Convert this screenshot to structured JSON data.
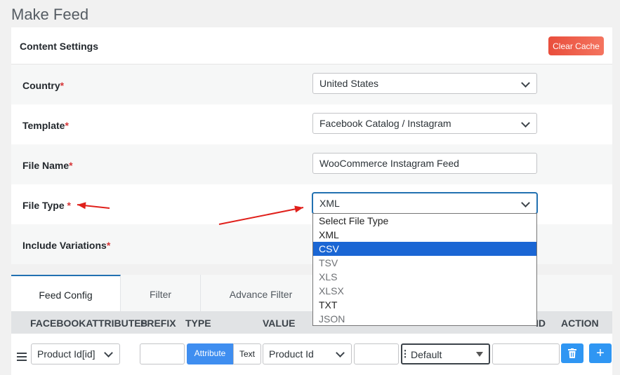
{
  "page": {
    "title": "Make Feed"
  },
  "content_settings": {
    "title": "Content Settings",
    "clear_cache_label": "Clear Cache",
    "fields": {
      "country": {
        "label": "Country",
        "required_mark": "*",
        "value": "United States"
      },
      "template": {
        "label": "Template",
        "required_mark": "*",
        "value": "Facebook Catalog / Instagram"
      },
      "file_name": {
        "label": "File Name",
        "required_mark": "*",
        "value": "WooCommerce Instagram Feed"
      },
      "file_type": {
        "label": "File Type",
        "required_mark": " *",
        "value": "XML"
      },
      "include_variations": {
        "label": "Include Variations",
        "required_mark": "*"
      }
    }
  },
  "file_type_dropdown": {
    "options": [
      "Select File Type",
      "XML",
      "CSV",
      "TSV",
      "XLS",
      "XLSX",
      "TXT",
      "JSON"
    ],
    "highlighted": "CSV"
  },
  "tabs": [
    "Feed Config",
    "Filter",
    "Advance Filter"
  ],
  "table": {
    "headers": {
      "attributes": "FACEBOOKATTRIBUTES",
      "prefix": "PREFIX",
      "type": "TYPE",
      "value": "VALUE",
      "suffix_partial": "ID",
      "action": "ACTION"
    },
    "row": {
      "attribute": "Product Id[id]",
      "type_attribute": "Attribute",
      "type_text": "Text",
      "value": "Product Id",
      "output": "Default"
    }
  },
  "icons": {
    "drag": "drag-handle-icon",
    "delete": "trash-icon",
    "add": "plus-icon"
  },
  "colors": {
    "accent": "#2271b1",
    "clear_cache": "#e94e3c",
    "dropdown_highlight": "#1a66d4",
    "arrow": "#e0201b",
    "action_button": "#2f96f3"
  }
}
